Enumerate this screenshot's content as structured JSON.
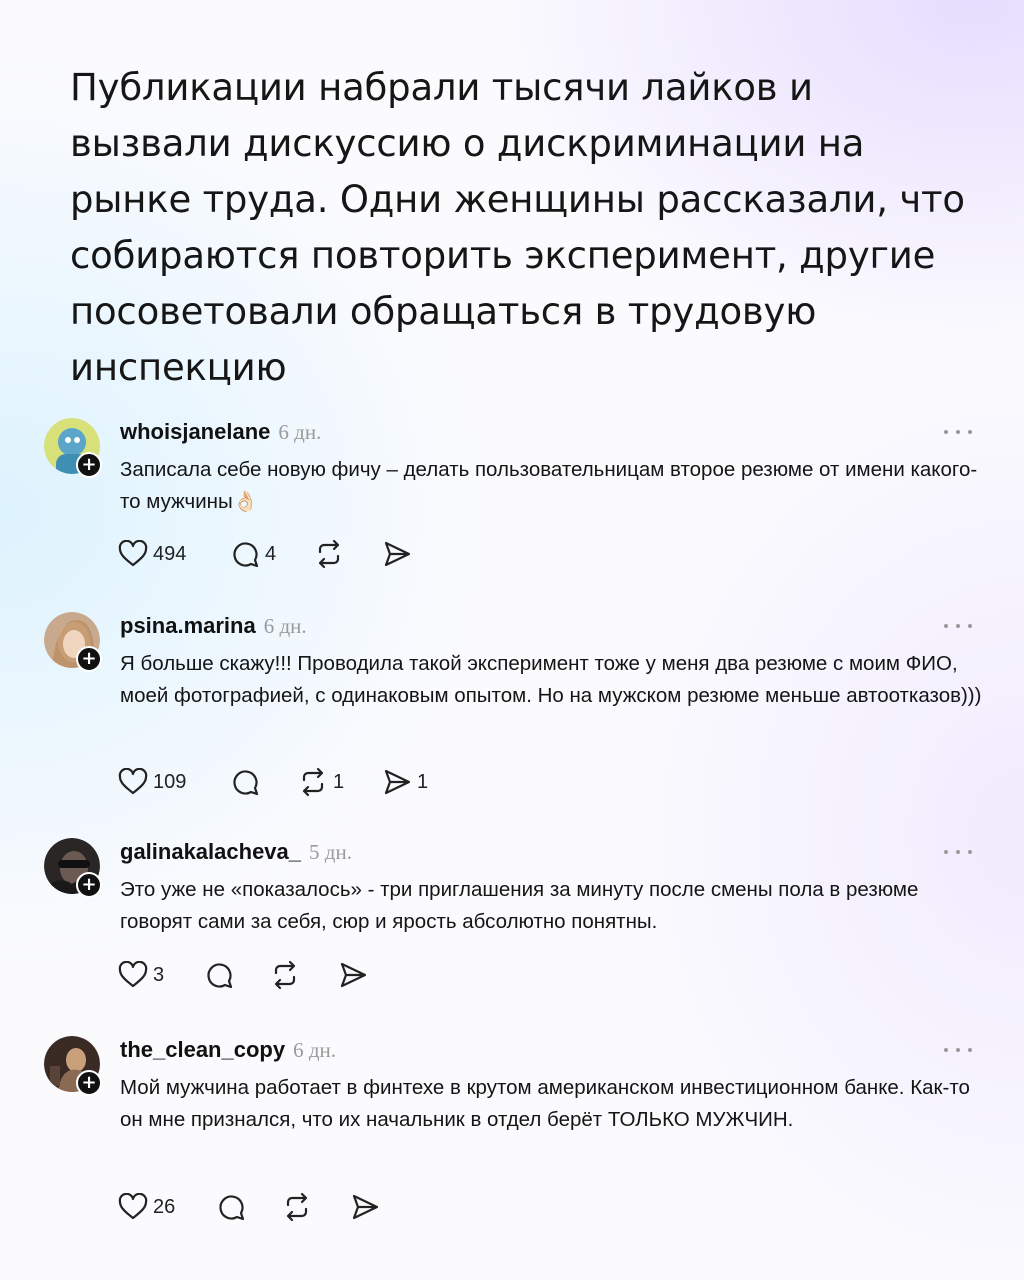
{
  "headline": "Публикации набрали тысячи лайков и вызвали дискуссию о дискриминации на рынке труда. Одни женщины рассказали, что собираются повторить эксперимент, другие посоветовали обращаться в трудовую инспекцию",
  "comments": [
    {
      "username": "whoisjanelane",
      "time": "6 дн.",
      "text": "Записала себе новую фичу – делать пользовательницам второе резюме от имени какого-то мужчины👌🏻",
      "likes": "494",
      "replies": "4",
      "reposts": "",
      "shares": ""
    },
    {
      "username": "psina.marina",
      "time": "6 дн.",
      "text": "Я больше скажу!!! Проводила такой эксперимент тоже у меня два резюме с моим ФИО, моей фотографией, с одинаковым опытом. Но на мужском резюме меньше автоотказов)))",
      "likes": "109",
      "replies": "",
      "reposts": "1",
      "shares": "1"
    },
    {
      "username": "galinakalacheva_",
      "time": "5 дн.",
      "text": "Это уже не «показалось» - три приглашения за минуту после смены пола в резюме говорят сами за себя, сюр и ярость абсолютно понятны.",
      "likes": "3",
      "replies": "",
      "reposts": "",
      "shares": ""
    },
    {
      "username": "the_clean_copy",
      "time": "6 дн.",
      "text": "Мой мужчина работает в финтехе в крутом американском инвестиционном банке. Как-то он мне признался, что их начальник в отдел берёт ТОЛЬКО МУЖЧИН.",
      "likes": "26",
      "replies": "",
      "reposts": "",
      "shares": ""
    }
  ],
  "icons": {
    "like": "heart-icon",
    "reply": "comment-icon",
    "repost": "repost-icon",
    "share": "send-icon",
    "more": "more-icon",
    "follow": "plus-icon"
  }
}
